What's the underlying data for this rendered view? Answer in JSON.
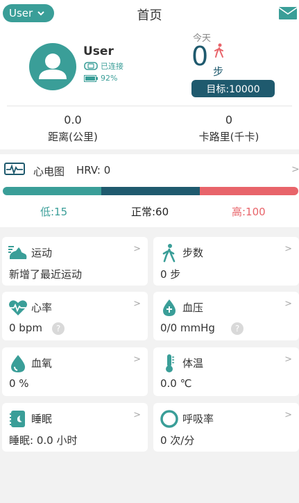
{
  "header": {
    "user_button": "User",
    "title": "首页"
  },
  "profile": {
    "name": "User",
    "connection_status": "已连接",
    "battery": "92%"
  },
  "steps": {
    "today_label": "今天",
    "count": "0",
    "unit": "步",
    "goal": "目标:10000"
  },
  "stats": {
    "distance_value": "0.0",
    "distance_label": "距离(公里)",
    "calories_value": "0",
    "calories_label": "卡路里(千卡)"
  },
  "ecg": {
    "title": "心电图",
    "hrv": "HRV: 0",
    "low_label": "低:15",
    "normal_label": "正常:60",
    "high_label": "高:100",
    "colors": {
      "low": "#3a9e98",
      "normal": "#1f5a6e",
      "high": "#e8646a"
    }
  },
  "cards": [
    {
      "title": "运动",
      "value": "新增了最近运动",
      "icon": "shoe-icon"
    },
    {
      "title": "步数",
      "value": "0 步",
      "icon": "walking-icon"
    },
    {
      "title": "心率",
      "value": "0 bpm",
      "icon": "heart-rate-icon"
    },
    {
      "title": "血压",
      "value": "0/0 mmHg",
      "icon": "blood-drop-icon"
    },
    {
      "title": "血氧",
      "value": "0 %",
      "icon": "oxygen-drop-icon"
    },
    {
      "title": "体温",
      "value": "0.0 ℃",
      "icon": "thermometer-icon"
    },
    {
      "title": "睡眠",
      "value": "睡眠: 0.0 小时",
      "icon": "sleep-icon"
    },
    {
      "title": "呼吸率",
      "value": "0 次/分",
      "icon": "breath-ring-icon"
    }
  ],
  "glyphs": {
    "arrow": ">",
    "help": "?"
  },
  "theme": {
    "accent": "#3a9e98",
    "dark": "#1f5a6e",
    "high": "#e8646a"
  }
}
